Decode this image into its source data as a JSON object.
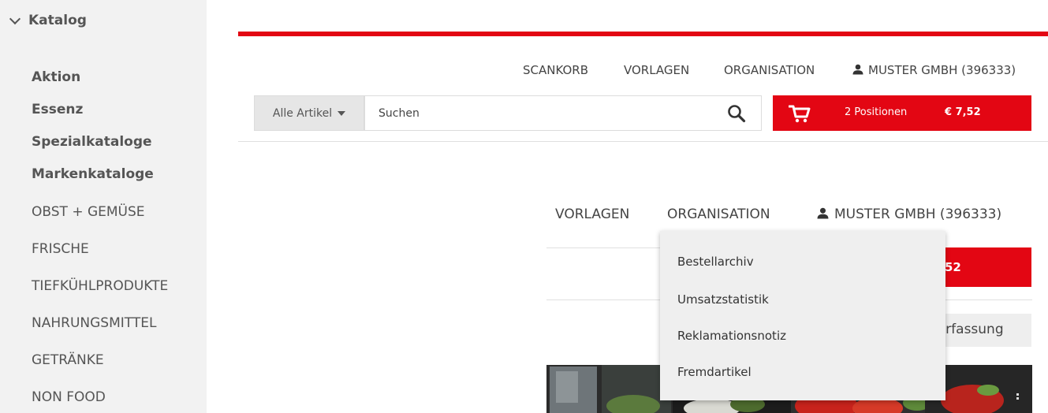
{
  "sidebar": {
    "heading": "Katalog",
    "items": [
      {
        "label": "Aktion",
        "bold": true
      },
      {
        "label": "Essenz",
        "bold": true
      },
      {
        "label": "Spezialkataloge",
        "bold": true
      },
      {
        "label": "Markenkataloge",
        "bold": true
      },
      {
        "label": "OBST + GEMÜSE",
        "bold": false
      },
      {
        "label": "FRISCHE",
        "bold": false
      },
      {
        "label": "TIEFKÜHLPRODUKTE",
        "bold": false
      },
      {
        "label": "NAHRUNGSMITTEL",
        "bold": false
      },
      {
        "label": "GETRÄNKE",
        "bold": false
      },
      {
        "label": "NON FOOD",
        "bold": false
      }
    ]
  },
  "topnav": {
    "scankorb": "SCANKORB",
    "vorlagen": "VORLAGEN",
    "organisation": "ORGANISATION",
    "user": "MUSTER GMBH (396333)"
  },
  "search": {
    "scope": "Alle Artikel",
    "placeholder": "Suchen"
  },
  "cart": {
    "positions": "2 Positionen",
    "total": "€ 7,52"
  },
  "nav2": {
    "vorlagen": "VORLAGEN",
    "organisation": "ORGANISATION",
    "user": "MUSTER GMBH (396333)"
  },
  "partial": {
    "cart_fragment": "52",
    "erfassung_fragment": "lerfassung"
  },
  "organisation_menu": {
    "items": [
      "Bestellarchiv",
      "Umsatzstatistik",
      "Reklamationsnotiz",
      "Fremdartikel"
    ]
  },
  "colors": {
    "brand_red": "#e30613",
    "sidebar_bg": "#f2f2f2",
    "menu_bg": "#efefef"
  },
  "icons": [
    "chevron-down-icon",
    "user-icon",
    "caret-down-icon",
    "search-icon",
    "cart-icon"
  ]
}
